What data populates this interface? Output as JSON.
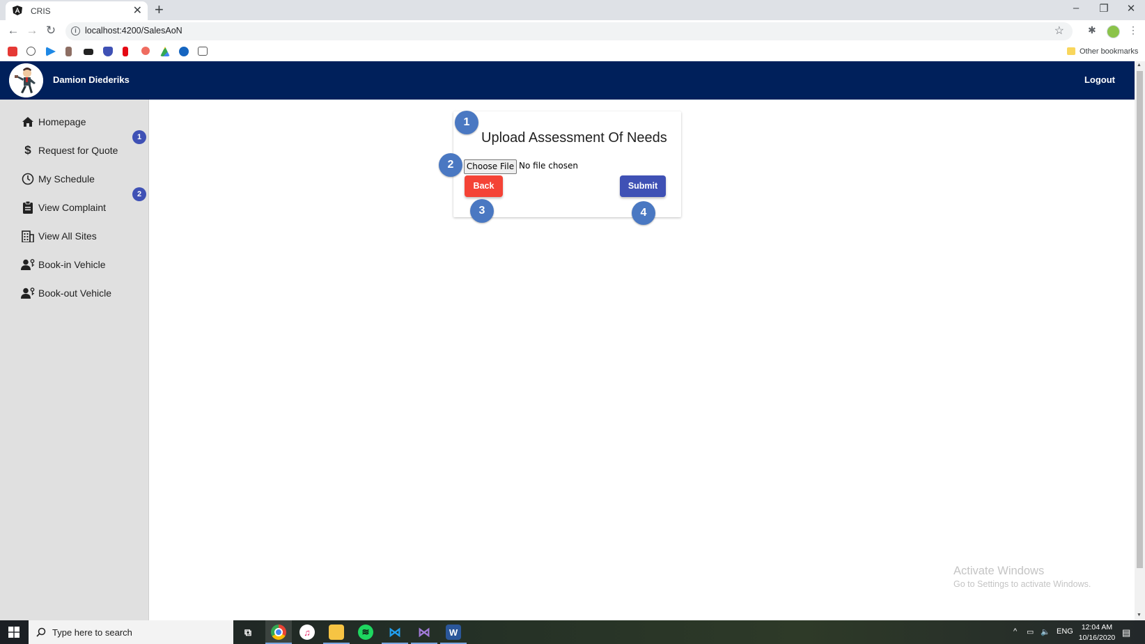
{
  "browser": {
    "tab_title": "CRIS",
    "tab_close": "✕",
    "new_tab": "+",
    "url": "localhost:4200/SalesAoN",
    "other_bookmarks": "Other bookmarks",
    "minimize": "–",
    "restore": "❐",
    "close": "✕"
  },
  "header": {
    "user_name": "Damion Diederiks",
    "logout": "Logout",
    "bg_color": "#00205b"
  },
  "sidebar": {
    "items": [
      {
        "label": "Homepage",
        "icon": "home-icon"
      },
      {
        "label": "Request for Quote",
        "icon": "dollar-icon"
      },
      {
        "label": "My Schedule",
        "icon": "clock-icon"
      },
      {
        "label": "View Complaint",
        "icon": "clipboard-icon"
      },
      {
        "label": "View All Sites",
        "icon": "building-icon"
      },
      {
        "label": "Book-in Vehicle",
        "icon": "user-key-icon"
      },
      {
        "label": "Book-out Vehicle",
        "icon": "user-key-icon"
      }
    ],
    "badges": [
      "1",
      "2"
    ]
  },
  "form": {
    "title": "Upload Assessment Of Needs",
    "choose_file": "Choose File",
    "file_status": "No file chosen",
    "back": "Back",
    "submit": "Submit",
    "back_color": "#f44336",
    "submit_color": "#3f51b5"
  },
  "steps": [
    "1",
    "2",
    "3",
    "4"
  ],
  "watermark": {
    "title": "Activate Windows",
    "subtitle": "Go to Settings to activate Windows."
  },
  "taskbar": {
    "search_placeholder": "Type here to search",
    "lang": "ENG",
    "time": "12:04 AM",
    "date": "10/16/2020"
  }
}
